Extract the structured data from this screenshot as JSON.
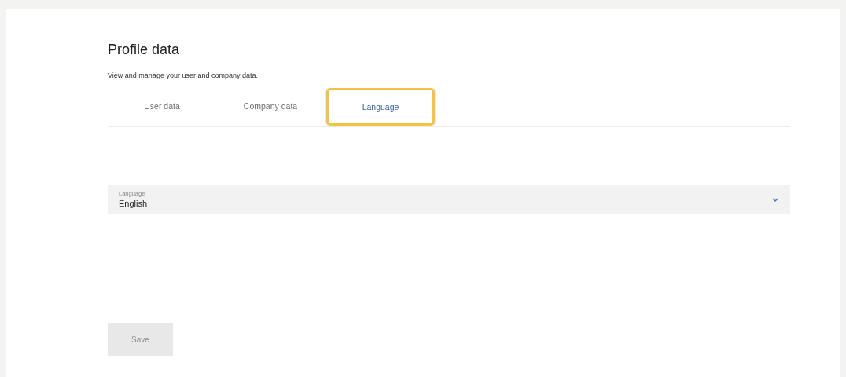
{
  "page": {
    "title": "Profile data",
    "description": "View and manage your user and company data."
  },
  "tabs": [
    {
      "label": "User data",
      "selected": false
    },
    {
      "label": "Company data",
      "selected": false
    },
    {
      "label": "Language",
      "selected": true
    }
  ],
  "language_select": {
    "label": "Language",
    "value": "English"
  },
  "save_button": {
    "label": "Save",
    "disabled": true
  }
}
